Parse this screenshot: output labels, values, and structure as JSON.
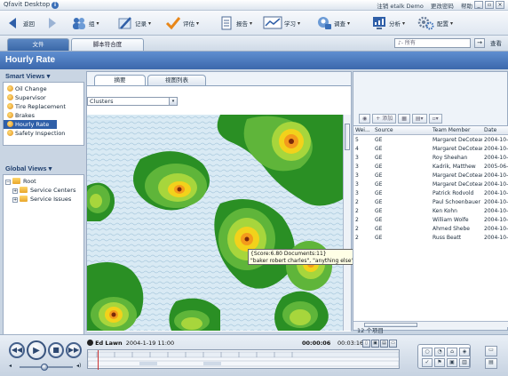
{
  "titlebar": {
    "app_title": "Qfavit Desktop",
    "links": [
      "注销 etalk Demo",
      "更改密码",
      "帮助"
    ],
    "win_min": "_",
    "win_max": "▫",
    "win_close": "×"
  },
  "toolbar": {
    "back_label": "返回",
    "group_label": "组",
    "record_label": "记录",
    "review_label": "评估",
    "report_label": "报告",
    "learn_label": "学习",
    "survey_label": "调查",
    "analysis_label": "分析",
    "config_label": "配置"
  },
  "tabs": {
    "files": "文件",
    "script": "脚本符合度",
    "search_placeholder": "♪- 所有",
    "extra": "查看"
  },
  "page_title": "Hourly Rate",
  "smart_views": {
    "title": "Smart Views",
    "items": [
      "Oil Change",
      "Supervisor",
      "Tire Replacement",
      "Brakes",
      "Hourly Rate",
      "Safety Inspection"
    ]
  },
  "global_views": {
    "title": "Global Views",
    "root": "Root",
    "children": [
      "Service Centers",
      "Service Issues"
    ]
  },
  "center": {
    "tab_summary": "摘要",
    "tab_list": "视图列表",
    "select_value": "Clusters",
    "tooltip_line1": "{Score:6.80 Documents:11}",
    "tooltip_line2": "\"baker robert charles\", \"anything else\", \"before too\""
  },
  "right": {
    "tool_add": "添加",
    "columns": [
      "Wei...",
      "Source",
      "Team Member",
      "Date"
    ],
    "rows": [
      [
        "5",
        "GE",
        "Margaret DeCoteau",
        "2004-10-C"
      ],
      [
        "4",
        "GE",
        "Margaret DeCoteau",
        "2004-10-C"
      ],
      [
        "3",
        "GE",
        "Roy Sheehan",
        "2004-10-C"
      ],
      [
        "3",
        "GE",
        "Kadrik, Matthew",
        "2005-06-1"
      ],
      [
        "3",
        "GE",
        "Margaret DeCoteau",
        "2004-10-C"
      ],
      [
        "3",
        "GE",
        "Margaret DeCoteau",
        "2004-10-C"
      ],
      [
        "3",
        "GE",
        "Patrick Rodvold",
        "2004-10-C"
      ],
      [
        "2",
        "GE",
        "Paul Schoenbauer",
        "2004-10-C"
      ],
      [
        "2",
        "GE",
        "Ken Kohn",
        "2004-10-C"
      ],
      [
        "2",
        "GE",
        "William Wolfe",
        "2004-10-C"
      ],
      [
        "2",
        "GE",
        "Ahmed Shebe",
        "2004-10-C"
      ],
      [
        "2",
        "GE",
        "Russ Beatt",
        "2004-10-C"
      ]
    ],
    "items_count": "12 个项目"
  },
  "player": {
    "track_name": "Ed Lawn",
    "track_date": "2004-1-19 11:00",
    "current_time": "00:00:06",
    "duration": "00:03:16",
    "progress": 0.03
  },
  "colors": {
    "header_blue": "#3b68ac",
    "selection_blue": "#2f5fa8",
    "map_land": "#1e8a1e",
    "map_water": "#d6e8f2"
  }
}
